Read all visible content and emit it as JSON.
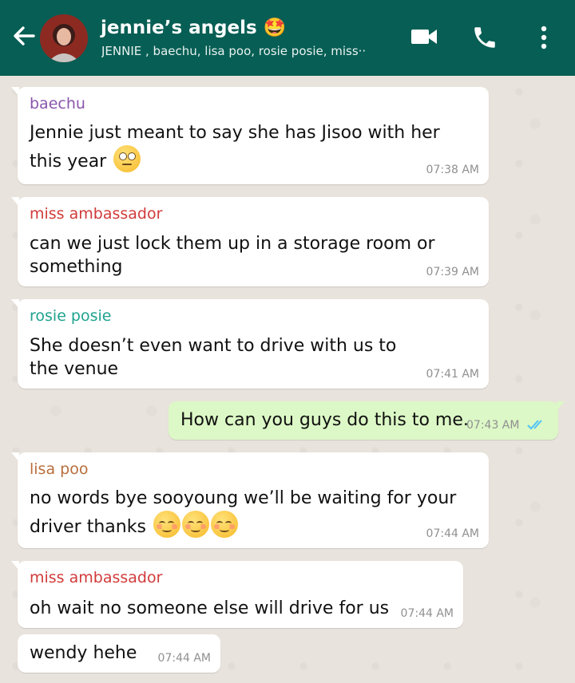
{
  "header": {
    "title": "jennie’s angels 🤩",
    "subtitle": "JENNIE , baechu, lisa poo, rosie posie, miss··",
    "icons": [
      "back-arrow-icon",
      "video-call-icon",
      "phone-icon",
      "more-vert-icon"
    ]
  },
  "colors": {
    "header_bg": "#075e54",
    "chat_bg": "#e8e3dc",
    "incoming_bubble": "#ffffff",
    "outgoing_bubble": "#dcf8c6",
    "read_ticks": "#4fc3f7"
  },
  "messages": [
    {
      "sender": "baechu",
      "sender_color": "#8a56ac",
      "text": "Jennie just meant to say she has Jisoo with her this year",
      "emoji": "rolling-eyes-emoji",
      "time": "07:38 AM"
    },
    {
      "sender": "miss ambassador",
      "sender_color": "#d13a3a",
      "text": "can we just lock them up in a storage room or something",
      "time": "07:39 AM"
    },
    {
      "sender": "rosie posie",
      "sender_color": "#1fa38f",
      "text": "She doesn’t even want to drive with us to the venue",
      "time": "07:41 AM"
    },
    {
      "sender": "",
      "outgoing": true,
      "text": "How can you guys do this to me.",
      "time": "07:43 AM",
      "status": "read"
    },
    {
      "sender": "lisa poo",
      "sender_color": "#b86e3c",
      "text": "no words bye sooyoung we’ll be waiting for your driver thanks",
      "emoji": "smiling-face-emoji x3",
      "time": "07:44 AM"
    },
    {
      "sender": "miss ambassador",
      "sender_color": "#d13a3a",
      "text": "oh wait no someone else will drive for us",
      "time": "07:44 AM"
    },
    {
      "sender": "",
      "text": "wendy hehe",
      "time": "07:44 AM"
    }
  ]
}
